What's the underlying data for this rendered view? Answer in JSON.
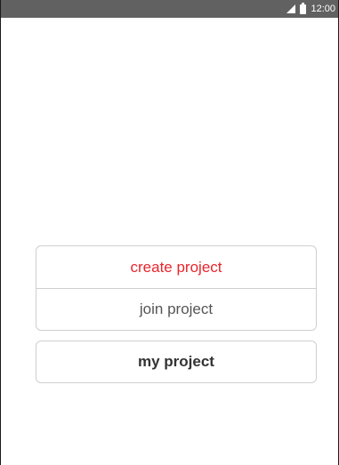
{
  "status_bar": {
    "time": "12:00",
    "icons": [
      "signal-icon",
      "battery-icon"
    ],
    "background": "#616161"
  },
  "actions": {
    "create_label": "create project",
    "join_label": "join project",
    "my_label": "my project"
  },
  "colors": {
    "accent": "#e8262c",
    "text": "#555555",
    "border": "#cfcfcf"
  }
}
